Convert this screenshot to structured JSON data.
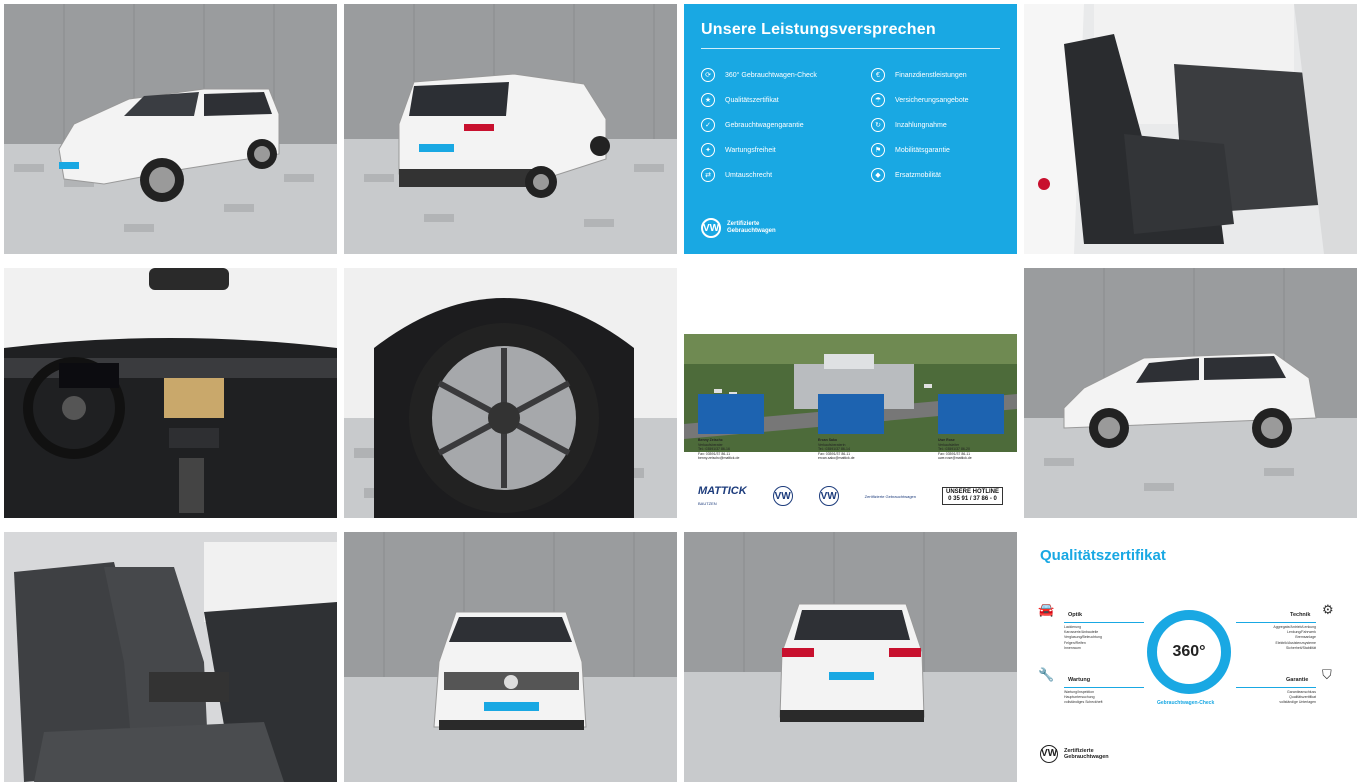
{
  "gallery": {
    "promise": {
      "title": "Unsere Leistungsversprechen",
      "left_items": [
        "360° Gebrauchtwagen-Check",
        "Qualitätszertifikat",
        "Gebrauchtwagengarantie",
        "Wartungsfreiheit",
        "Umtauschrecht"
      ],
      "right_items": [
        "Finanzdienstleistungen",
        "Versicherungsangebote",
        "Inzahlungnahme",
        "Mobilitätsgarantie",
        "Ersatzmobilität"
      ],
      "brand_line1": "Zertifizierte",
      "brand_line2": "Gebrauchtwagen",
      "logo_letters": "VW",
      "background_color": "#19a8e3"
    },
    "dealer": {
      "staff": [
        {
          "name": "Benny Zeischc",
          "role": "Verkaufsberater",
          "tel": "Tel.: 03591/37 86-16",
          "fax": "Fax: 03591/37 86-11",
          "mail": "benny.zeischc@mattick.de"
        },
        {
          "name": "Ercan Sako",
          "role": "Verkaufsberaterin",
          "tel": "Tel.: 03591/37 86-14",
          "fax": "Fax: 03591/37 86-11",
          "mail": "ercan.sako@mattick.de"
        },
        {
          "name": "Uwe Rose",
          "role": "Verkaufsleiter",
          "tel": "Tel.: 03591/37 86-20",
          "fax": "Fax: 03591/37 86-11",
          "mail": "uwe.rose@mattick.de"
        }
      ],
      "logo_name": "MATTICK",
      "logo_city": "BAUTZEN",
      "vw_letters": "VW",
      "brand_small": "Zertifizierte Gebrauchtwagen",
      "hotline_title": "UNSERE HOTLINE",
      "hotline_number": "0 35 91 / 37 86 - 0"
    },
    "quality": {
      "title": "Qualitätszertifikat",
      "center": "360°",
      "ring_text": "Gebrauchtwagen-Check",
      "optik": {
        "label": "Optik",
        "items": [
          "Lackierung",
          "Karosserie/Anbauteile",
          "Verglasung/Beleuchtung",
          "Felgen/Reifen",
          "Innenraum"
        ]
      },
      "technik": {
        "label": "Technik",
        "items": [
          "Aggregate/Antrieb/Lenkung",
          "Lenkung/Fahrwerk",
          "Bremsanlage",
          "Elektrik/Assistenzsysteme",
          "Sicherheit/Stabilität"
        ]
      },
      "wartung": {
        "label": "Wartung",
        "items": [
          "Wartung/Inspektion",
          "Hauptuntersuchung",
          "vollständiges Scheckheft"
        ]
      },
      "garantie": {
        "label": "Garantie",
        "items": [
          "Garantieanschluss",
          "Qualitätszertifikat",
          "vollständige Unterlagen"
        ]
      },
      "brand_line1": "Zertifizierte",
      "brand_line2": "Gebrauchtwagen",
      "accent_color": "#19a8e3"
    }
  }
}
